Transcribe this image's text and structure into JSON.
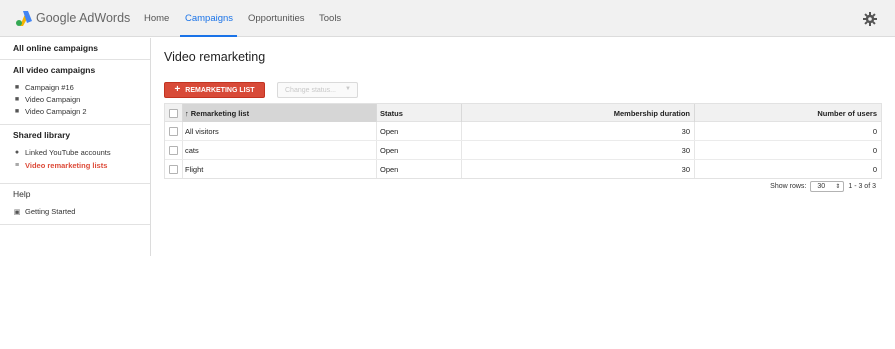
{
  "header": {
    "brand": "Google AdWords",
    "nav": [
      {
        "label": "Home",
        "active": false
      },
      {
        "label": "Campaigns",
        "active": true
      },
      {
        "label": "Opportunities",
        "active": false
      },
      {
        "label": "Tools",
        "active": false
      }
    ],
    "settings_icon": "gear-icon",
    "accent_color": "#1a73e8"
  },
  "sidebar": {
    "all_online": "All online campaigns",
    "all_video": "All video campaigns",
    "campaigns": [
      "Campaign #16",
      "Video Campaign",
      "Video Campaign 2"
    ],
    "shared_library": "Shared library",
    "library_items": [
      "Linked YouTube accounts",
      "Video remarketing lists"
    ],
    "active_item": "Video remarketing lists",
    "help": "Help",
    "help_items": [
      "Getting Started"
    ]
  },
  "main": {
    "title": "Video remarketing",
    "add_button": "REMARKETING LIST",
    "add_button_color": "#d84a38",
    "change_status": "Change status...",
    "table": {
      "columns": [
        "Remarketing list",
        "Status",
        "Membership duration",
        "Number of users"
      ],
      "sorted_column": "Remarketing list",
      "rows": [
        {
          "name": "All visitors",
          "status": "Open",
          "duration": "30",
          "users": "0"
        },
        {
          "name": "cats",
          "status": "Open",
          "duration": "30",
          "users": "0"
        },
        {
          "name": "Flight",
          "status": "Open",
          "duration": "30",
          "users": "0"
        }
      ]
    },
    "pager": {
      "show_rows_label": "Show rows:",
      "rows_value": "30",
      "range": "1 - 3 of 3"
    }
  }
}
